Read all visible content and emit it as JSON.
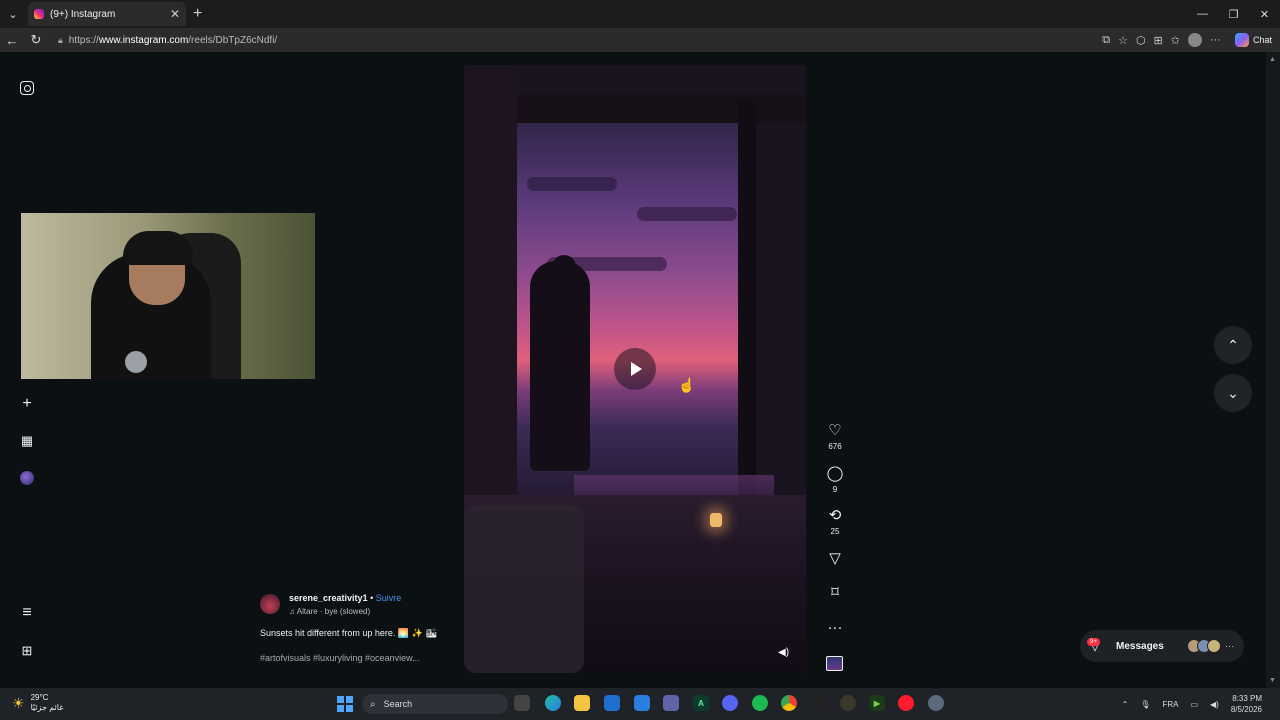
{
  "browser": {
    "tab_title": "(9+) Instagram",
    "tab_close": "✕",
    "new_tab": "+",
    "url_prefix": "https://",
    "url_host": "www.instagram.com",
    "url_path": "/reels/DbTpZ6cNdfi/",
    "chat_label": "Chat"
  },
  "post": {
    "author": "serene_creativity1",
    "separator": "•",
    "follow_label": "Suivre",
    "audio": "Altare · bye (slowed)",
    "caption": "Sunsets hit different from up here. 🌅 ✨ 🏙",
    "hashtags": "#artofvisuals #luxuryliving #oceanview..."
  },
  "actions": {
    "likes": "676",
    "comments": "9",
    "reposts": "25",
    "more": "···"
  },
  "messages": {
    "label": "Messages",
    "badge": "9+",
    "more": "···"
  },
  "taskbar": {
    "temperature": "29°C",
    "weather_sub": "غائم جزئيًا",
    "search_placeholder": "Search",
    "language": "FRA",
    "time": "8:33 PM",
    "date": "8/5/2026"
  },
  "colors": {
    "accent_link": "#4d8ef7",
    "notification": "#ff3040",
    "page_bg": "#0b1013"
  }
}
